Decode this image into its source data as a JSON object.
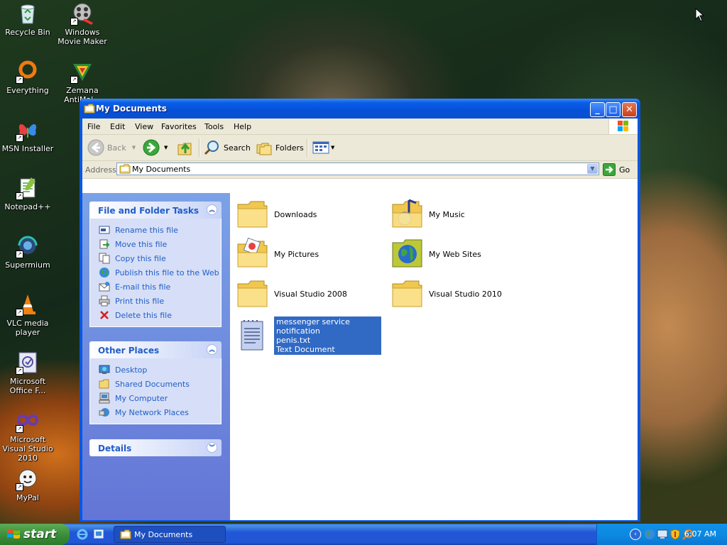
{
  "desktop": {
    "icons": [
      {
        "label": "Recycle Bin"
      },
      {
        "label": "Windows Movie Maker"
      },
      {
        "label": "Everything"
      },
      {
        "label": "Zemana AntiMal..."
      },
      {
        "label": "MSN Installer"
      },
      {
        "label": "Notepad++"
      },
      {
        "label": "Supermium"
      },
      {
        "label": "VLC media player"
      },
      {
        "label": "Microsoft Office F..."
      },
      {
        "label": "Microsoft Visual Studio 2010"
      },
      {
        "label": "MyPal"
      }
    ]
  },
  "window": {
    "title": "My Documents",
    "menu": [
      "File",
      "Edit",
      "View",
      "Favorites",
      "Tools",
      "Help"
    ],
    "toolbar": {
      "back": "Back",
      "search": "Search",
      "folders": "Folders"
    },
    "address": {
      "label": "Address",
      "value": "My Documents",
      "go": "Go"
    },
    "taskpane": {
      "file_tasks": {
        "title": "File and Folder Tasks",
        "items": [
          "Rename this file",
          "Move this file",
          "Copy this file",
          "Publish this file to the Web",
          "E-mail this file",
          "Print this file",
          "Delete this file"
        ]
      },
      "other_places": {
        "title": "Other Places",
        "items": [
          "Desktop",
          "Shared Documents",
          "My Computer",
          "My Network Places"
        ]
      },
      "details": {
        "title": "Details"
      }
    },
    "items": [
      {
        "name": "Downloads"
      },
      {
        "name": "My Music"
      },
      {
        "name": "My Pictures"
      },
      {
        "name": "My Web Sites"
      },
      {
        "name": "Visual Studio 2008"
      },
      {
        "name": "Visual Studio 2010"
      },
      {
        "name_line1": "messenger service notification",
        "name_line2": "penis.txt",
        "type": "Text Document"
      }
    ]
  },
  "taskbar": {
    "start": "start",
    "task": "My Documents",
    "clock": "6:07 AM"
  },
  "colors": {
    "titlebar": "#0a5ee8",
    "taskpane_link": "#215dc6",
    "selection": "#316ac5",
    "start_green": "#3c8f3b"
  }
}
